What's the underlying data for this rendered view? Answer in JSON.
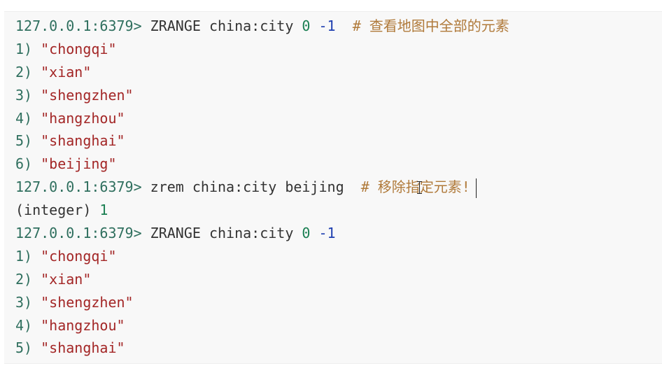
{
  "terminal": {
    "lines": [
      {
        "kind": "command",
        "prompt": "127.0.0.1:6379>",
        "command": "ZRANGE china:city",
        "arg1": "0",
        "arg2": "-1",
        "comment": "# 查看地图中全部的元素"
      },
      {
        "kind": "item",
        "index": "1)",
        "value": "\"chongqi\""
      },
      {
        "kind": "item",
        "index": "2)",
        "value": "\"xian\""
      },
      {
        "kind": "item",
        "index": "3)",
        "value": "\"shengzhen\""
      },
      {
        "kind": "item",
        "index": "4)",
        "value": "\"hangzhou\""
      },
      {
        "kind": "item",
        "index": "5)",
        "value": "\"shanghai\""
      },
      {
        "kind": "item",
        "index": "6)",
        "value": "\"beijing\""
      },
      {
        "kind": "command2",
        "prompt": "127.0.0.1:6379>",
        "command": "zrem china:city beijing",
        "comment_a": "# 移除指",
        "comment_b": "定元素!"
      },
      {
        "kind": "integer",
        "label": "(integer)",
        "value": "1"
      },
      {
        "kind": "command",
        "prompt": "127.0.0.1:6379>",
        "command": "ZRANGE china:city",
        "arg1": "0",
        "arg2": "-1",
        "comment": ""
      },
      {
        "kind": "item",
        "index": "1)",
        "value": "\"chongqi\""
      },
      {
        "kind": "item",
        "index": "2)",
        "value": "\"xian\""
      },
      {
        "kind": "item",
        "index": "3)",
        "value": "\"shengzhen\""
      },
      {
        "kind": "item",
        "index": "4)",
        "value": "\"hangzhou\""
      },
      {
        "kind": "item",
        "index": "5)",
        "value": "\"shanghai\""
      }
    ]
  },
  "colors": {
    "background": "#f8f8f8",
    "prompt": "#2f6f5e",
    "string": "#a32626",
    "number_zero": "#1a7f52",
    "number_negative": "#1f3fb0",
    "comment": "#b07a3a"
  }
}
